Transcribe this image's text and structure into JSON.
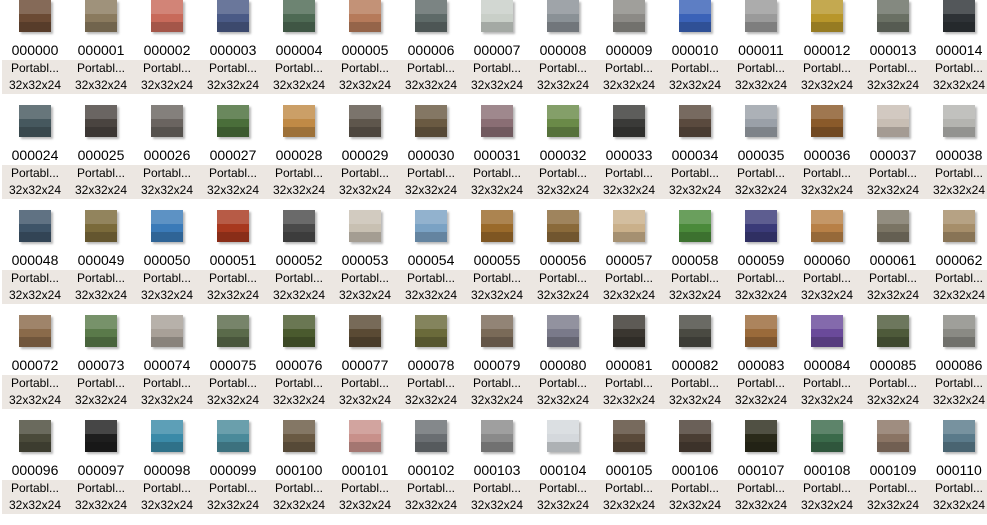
{
  "type_label": "Portabl...",
  "dims_label": "32x32x24",
  "rows": [
    {
      "files": [
        {
          "name": "000000",
          "color": "#6b4a34"
        },
        {
          "name": "000001",
          "color": "#8a7a5e"
        },
        {
          "name": "000002",
          "color": "#c86a5a"
        },
        {
          "name": "000003",
          "color": "#4a5a86"
        },
        {
          "name": "000004",
          "color": "#4e6a54"
        },
        {
          "name": "000005",
          "color": "#b67a5a"
        },
        {
          "name": "000006",
          "color": "#5e6a68"
        },
        {
          "name": "000007",
          "color": "#c9cfc8"
        },
        {
          "name": "000008",
          "color": "#8a9196"
        },
        {
          "name": "000009",
          "color": "#8c8a86"
        },
        {
          "name": "000010",
          "color": "#3a62b8"
        },
        {
          "name": "000011",
          "color": "#9a9a9a"
        },
        {
          "name": "000012",
          "color": "#b8962a"
        },
        {
          "name": "000013",
          "color": "#6a7064"
        },
        {
          "name": "000014",
          "color": "#2e3236"
        }
      ]
    },
    {
      "files": [
        {
          "name": "000024",
          "color": "#46585e"
        },
        {
          "name": "000025",
          "color": "#4a4440"
        },
        {
          "name": "000026",
          "color": "#6a6460"
        },
        {
          "name": "000027",
          "color": "#4a6e3a"
        },
        {
          "name": "000028",
          "color": "#c08a46"
        },
        {
          "name": "000029",
          "color": "#5e564c"
        },
        {
          "name": "000030",
          "color": "#6a5a42"
        },
        {
          "name": "000031",
          "color": "#8a6e74"
        },
        {
          "name": "000032",
          "color": "#6a8a48"
        },
        {
          "name": "000033",
          "color": "#3a3a38"
        },
        {
          "name": "000034",
          "color": "#5a4a3e"
        },
        {
          "name": "000035",
          "color": "#9aa0a8"
        },
        {
          "name": "000036",
          "color": "#8a5a2a"
        },
        {
          "name": "000037",
          "color": "#c8beb4"
        },
        {
          "name": "000038",
          "color": "#b4b4b0"
        }
      ]
    },
    {
      "files": [
        {
          "name": "000048",
          "color": "#3e5468"
        },
        {
          "name": "000049",
          "color": "#7a6a3a"
        },
        {
          "name": "000050",
          "color": "#3a7ab8"
        },
        {
          "name": "000051",
          "color": "#a8381e"
        },
        {
          "name": "000052",
          "color": "#4a4a4a"
        },
        {
          "name": "000053",
          "color": "#c8c0b2"
        },
        {
          "name": "000054",
          "color": "#7aa2c4"
        },
        {
          "name": "000055",
          "color": "#9a6a2a"
        },
        {
          "name": "000056",
          "color": "#8a6a3a"
        },
        {
          "name": "000057",
          "color": "#cab08a"
        },
        {
          "name": "000058",
          "color": "#4a8a3a"
        },
        {
          "name": "000059",
          "color": "#3a3a78"
        },
        {
          "name": "000060",
          "color": "#b88046"
        },
        {
          "name": "000061",
          "color": "#7a7464"
        },
        {
          "name": "000062",
          "color": "#a68e6a"
        }
      ]
    },
    {
      "files": [
        {
          "name": "000072",
          "color": "#8a6a4a"
        },
        {
          "name": "000073",
          "color": "#5a7a4a"
        },
        {
          "name": "000074",
          "color": "#a8a098"
        },
        {
          "name": "000075",
          "color": "#5a6a4a"
        },
        {
          "name": "000076",
          "color": "#4a5a2e"
        },
        {
          "name": "000077",
          "color": "#5a4a34"
        },
        {
          "name": "000078",
          "color": "#6a6a3a"
        },
        {
          "name": "000079",
          "color": "#7a6a58"
        },
        {
          "name": "000080",
          "color": "#7a7a8a"
        },
        {
          "name": "000081",
          "color": "#3a3630"
        },
        {
          "name": "000082",
          "color": "#4a4a42"
        },
        {
          "name": "000083",
          "color": "#9a6a3a"
        },
        {
          "name": "000084",
          "color": "#6a4a9a"
        },
        {
          "name": "000085",
          "color": "#4e5a3a"
        },
        {
          "name": "000086",
          "color": "#8a8a84"
        }
      ]
    },
    {
      "files": [
        {
          "name": "000096",
          "color": "#4a4a3a"
        },
        {
          "name": "000097",
          "color": "#1e1e1e"
        },
        {
          "name": "000098",
          "color": "#3a8aa8"
        },
        {
          "name": "000099",
          "color": "#4a8a9a"
        },
        {
          "name": "000100",
          "color": "#6a5a44"
        },
        {
          "name": "000101",
          "color": "#c8908a"
        },
        {
          "name": "000102",
          "color": "#6a6e72"
        },
        {
          "name": "000103",
          "color": "#8a8a8a"
        },
        {
          "name": "000104",
          "color": "#d4d8dc"
        },
        {
          "name": "000105",
          "color": "#5a4a3a"
        },
        {
          "name": "000106",
          "color": "#4a3e34"
        },
        {
          "name": "000107",
          "color": "#2a2a1a"
        },
        {
          "name": "000108",
          "color": "#3a6a4a"
        },
        {
          "name": "000109",
          "color": "#8a7464"
        },
        {
          "name": "000110",
          "color": "#5a7a8a"
        }
      ]
    }
  ]
}
